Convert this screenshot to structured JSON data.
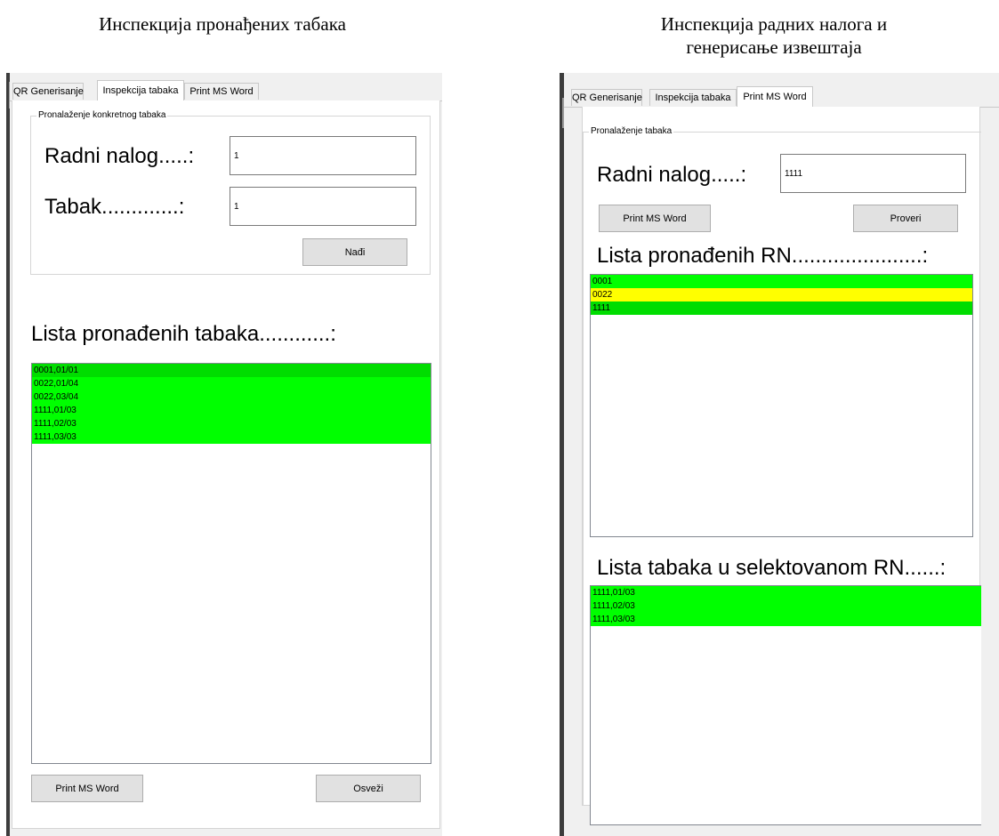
{
  "captions": {
    "left": "Инспекција пронађених табака",
    "right_line1": "Инспекција радних налога и",
    "right_line2": "генерисање извештаја"
  },
  "tabs": [
    "QR Generisanje",
    "Inspekcija tabaka",
    "Print MS Word"
  ],
  "left": {
    "active_tab": "Inspekcija tabaka",
    "group_title": "Pronalaženje konkretnog tabaka",
    "order_label": "Radni nalog.....:",
    "order_value": "1",
    "sheet_label": "Tabak.............:",
    "sheet_value": "1",
    "find_button": "Nađi",
    "list_title": "Lista pronađenih tabaka............:",
    "list_items": [
      "0001,01/01",
      "0022,01/04",
      "0022,03/04",
      "1111,01/03",
      "1111,02/03",
      "1111,03/03"
    ],
    "print_button": "Print MS Word",
    "refresh_button": "Osveži"
  },
  "right": {
    "active_tab": "Print MS Word",
    "group_title": "Pronalaženje tabaka",
    "order_label": "Radni nalog.....:",
    "order_value": "1111",
    "print_button": "Print MS Word",
    "check_button": "Proveri",
    "orders_title": "Lista pronađenih RN......................:",
    "orders": [
      "0001",
      "0022",
      "1111"
    ],
    "sheets_title": "Lista tabaka u selektovanom RN......:",
    "sheets": [
      "1111,01/03",
      "1111,02/03",
      "1111,03/03"
    ]
  },
  "colors": {
    "green": "#00ff00",
    "green_selected": "#00dd00",
    "yellow": "#ffff00"
  }
}
